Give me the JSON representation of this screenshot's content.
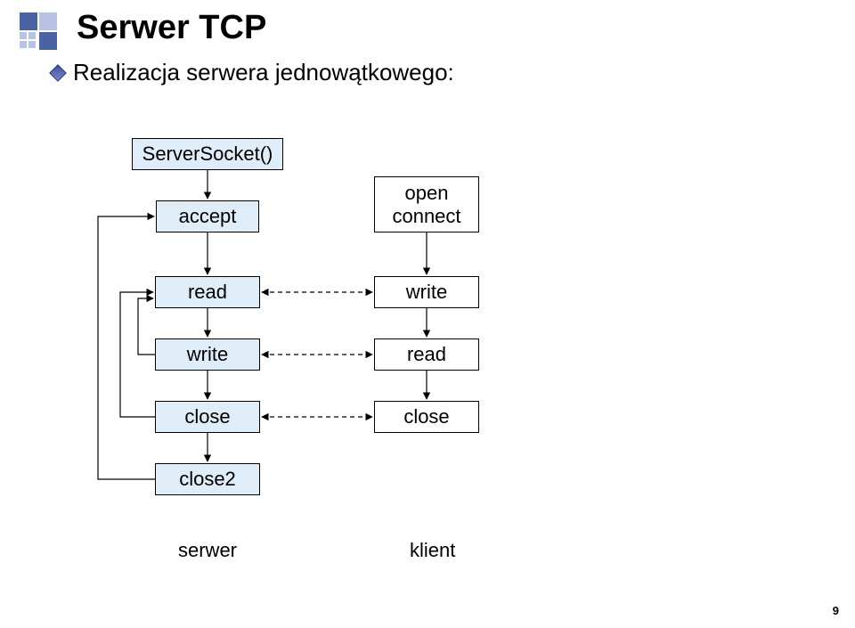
{
  "title": "Serwer TCP",
  "bullet": "Realizacja serwera jednowątkowego:",
  "server": {
    "socket": "ServerSocket()",
    "accept": "accept",
    "read": "read",
    "write": "write",
    "close": "close",
    "close2": "close2"
  },
  "client": {
    "open": "open\nconnect",
    "write": "write",
    "read": "read",
    "close": "close"
  },
  "labels": {
    "server": "serwer",
    "client": "klient"
  },
  "page": "9"
}
